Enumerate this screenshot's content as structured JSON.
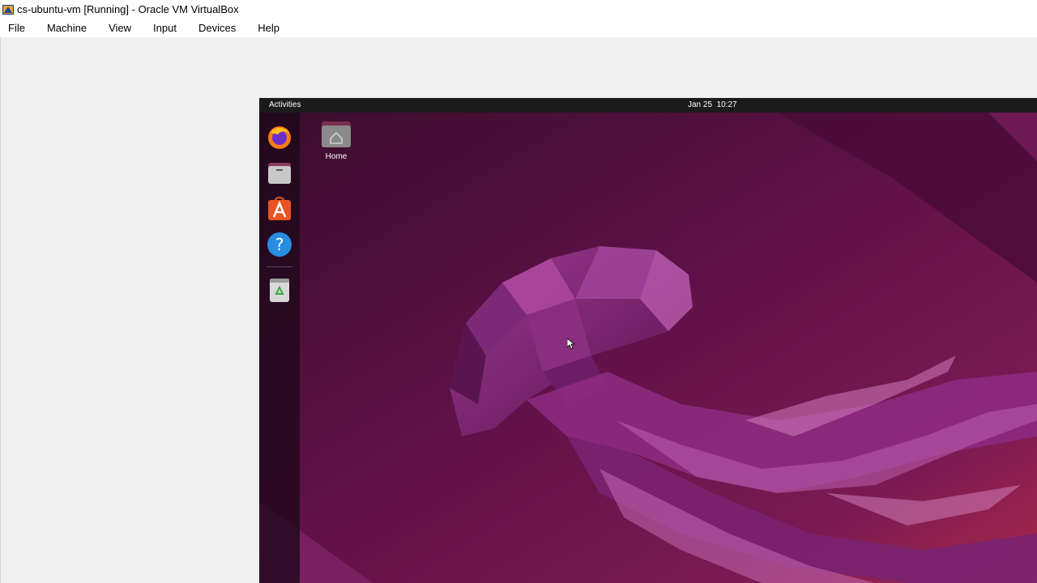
{
  "window": {
    "title": "cs-ubuntu-vm [Running] - Oracle VM VirtualBox",
    "icon": "virtualbox-icon"
  },
  "menu": {
    "items": [
      {
        "label": "File"
      },
      {
        "label": "Machine"
      },
      {
        "label": "View"
      },
      {
        "label": "Input"
      },
      {
        "label": "Devices"
      },
      {
        "label": "Help"
      }
    ]
  },
  "guest": {
    "topbar": {
      "activities_label": "Activities",
      "clock": "Jan 25  10:27"
    },
    "dock": {
      "items": [
        {
          "icon": "firefox-icon"
        },
        {
          "icon": "files-icon"
        },
        {
          "icon": "app-center-icon"
        },
        {
          "icon": "help-icon"
        },
        {
          "icon": "trash-icon"
        }
      ]
    },
    "desktop": {
      "home_label": "Home"
    },
    "colors": {
      "wallpaper_dark": "#2c001e",
      "wallpaper_mid": "#6b1550",
      "jellyfish": "#9a2c86",
      "topbar": "#1b1b1b"
    }
  }
}
